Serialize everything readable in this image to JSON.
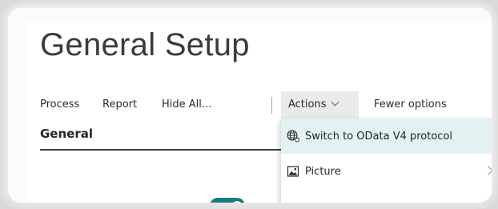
{
  "page": {
    "title": "General Setup"
  },
  "action_bar": {
    "items": [
      {
        "label": "Process"
      },
      {
        "label": "Report"
      },
      {
        "label": "Hide All..."
      }
    ],
    "actions_label": "Actions",
    "fewer_options_label": "Fewer options"
  },
  "dropdown": {
    "items": [
      {
        "label": "Switch to OData V4 protocol",
        "icon": "globe-refresh-icon",
        "highlighted": true
      },
      {
        "label": "Picture",
        "icon": "picture-icon",
        "has_submenu": true
      }
    ]
  },
  "section": {
    "title": "General"
  },
  "colors": {
    "accent": "#1e7b7d",
    "highlight": "#e3f1f2",
    "actions_bg": "#eaeaea"
  }
}
